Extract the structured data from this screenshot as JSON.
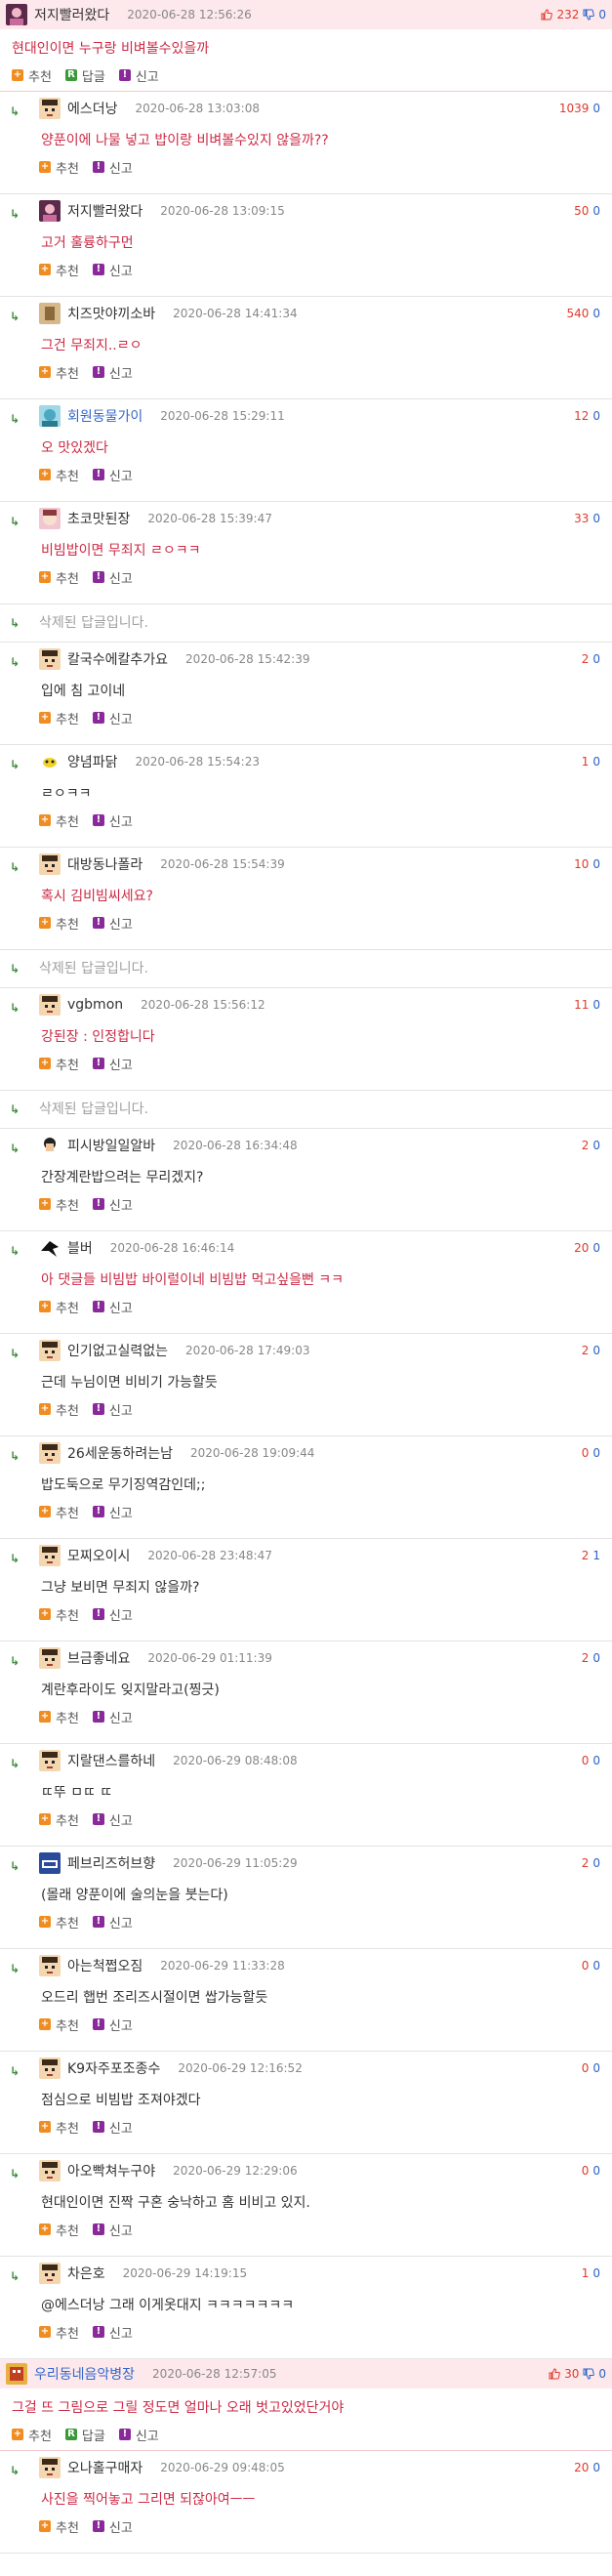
{
  "actions": {
    "recommend": "추천",
    "reply": "답글",
    "report": "신고"
  },
  "deleted_text": "삭제된 답글입니다.",
  "colors": {
    "top_header_bg": "#fde9ec",
    "comment_red": "#cc2a45",
    "reply_arrow": "#3b8c3b",
    "vote_up": "#e0392b",
    "vote_down": "#2a63c7",
    "recommend_icon": "#f08c20",
    "reply_icon": "#3a9a3a",
    "report_icon": "#8a2a9a"
  },
  "thread": [
    {
      "kind": "top",
      "nick": "저지빨러왔다",
      "date": "2020-06-28 12:56:26",
      "text": "현대인이면 누구랑 비벼볼수있을까",
      "up": "232",
      "down": "0",
      "avatar": "av-pink",
      "nick_color": "dark"
    },
    {
      "kind": "reply",
      "nick": "에스더낭",
      "date": "2020-06-28 13:03:08",
      "text": "양푼이에 나물 넣고 밥이랑 비벼볼수있지 않을까??",
      "up": "1039",
      "down": "0",
      "red": true,
      "avatar": "av-face"
    },
    {
      "kind": "reply",
      "nick": "저지빨러왔다",
      "date": "2020-06-28 13:09:15",
      "text": "고거 훌륭하구먼",
      "up": "50",
      "down": "0",
      "red": true,
      "avatar": "av-pink"
    },
    {
      "kind": "reply",
      "nick": "치즈맛야끼소바",
      "date": "2020-06-28 14:41:34",
      "text": "그건 무죄지..ㄹㅇ",
      "up": "540",
      "down": "0",
      "red": true,
      "avatar": "av-tan"
    },
    {
      "kind": "reply",
      "nick": "회원동물가이",
      "date": "2020-06-28 15:29:11",
      "text": "오 맛있겠다",
      "up": "12",
      "down": "0",
      "red": true,
      "avatar": "av-teal",
      "nick_color": "blue"
    },
    {
      "kind": "reply",
      "nick": "초코맛된장",
      "date": "2020-06-28 15:39:47",
      "text": "비빔밥이면 무죄지 ㄹㅇㅋㅋ",
      "up": "33",
      "down": "0",
      "red": true,
      "avatar": "av-anime"
    },
    {
      "kind": "deleted"
    },
    {
      "kind": "reply",
      "nick": "칼국수에칼추가요",
      "date": "2020-06-28 15:42:39",
      "text": "입에 침 고이네",
      "up": "2",
      "down": "0",
      "red": false,
      "avatar": "av-face"
    },
    {
      "kind": "reply",
      "nick": "양념파닭",
      "date": "2020-06-28 15:54:23",
      "text": "ㄹㅇㅋㅋ",
      "up": "1",
      "down": "0",
      "red": false,
      "avatar": "av-chick"
    },
    {
      "kind": "reply",
      "nick": "대방동나폴라",
      "date": "2020-06-28 15:54:39",
      "text": "혹시 김비빔씨세요?",
      "up": "10",
      "down": "0",
      "red": true,
      "avatar": "av-face"
    },
    {
      "kind": "deleted"
    },
    {
      "kind": "reply",
      "nick": "vgbmon",
      "date": "2020-06-28 15:56:12",
      "text": "강된장 : 인정합니다",
      "up": "11",
      "down": "0",
      "red": true,
      "avatar": "av-face"
    },
    {
      "kind": "deleted"
    },
    {
      "kind": "reply",
      "nick": "피시방일일알바",
      "date": "2020-06-28 16:34:48",
      "text": "간장계란밥으려는 무리겠지?",
      "up": "2",
      "down": "0",
      "red": false,
      "avatar": "av-man"
    },
    {
      "kind": "reply",
      "nick": "블버",
      "date": "2020-06-28 16:46:14",
      "text": "아 댓글들 비빔밥 바이럴이네 비빔밥 먹고싶을뻔 ㅋㅋ",
      "up": "20",
      "down": "0",
      "red": true,
      "avatar": "av-bird"
    },
    {
      "kind": "reply",
      "nick": "인기없고실력없는",
      "date": "2020-06-28 17:49:03",
      "text": "근데 누님이면 비비기 가능할듯",
      "up": "2",
      "down": "0",
      "red": false,
      "avatar": "av-face"
    },
    {
      "kind": "reply",
      "nick": "26세운동하려는남",
      "date": "2020-06-28 19:09:44",
      "text": "밥도둑으로 무기징역감인데;;",
      "up": "0",
      "down": "0",
      "red": false,
      "avatar": "av-face"
    },
    {
      "kind": "reply",
      "nick": "모찌오이시",
      "date": "2020-06-28 23:48:47",
      "text": "그냥 보비면 무죄지 않을까?",
      "up": "2",
      "down": "1",
      "red": false,
      "avatar": "av-face"
    },
    {
      "kind": "reply",
      "nick": "브금좋네요",
      "date": "2020-06-29 01:11:39",
      "text": "계란후라이도 잊지말라고(찡긋)",
      "up": "2",
      "down": "0",
      "red": false,
      "avatar": "av-face"
    },
    {
      "kind": "reply",
      "nick": "지랄댄스를하네",
      "date": "2020-06-29 08:48:08",
      "text": "ㄸ뚜 ㅁㄸ ㄸ",
      "up": "0",
      "down": "0",
      "red": false,
      "avatar": "av-face"
    },
    {
      "kind": "reply",
      "nick": "페브리즈허브향",
      "date": "2020-06-29 11:05:29",
      "text": "(몰래 양푼이에 술의눈을 붓는다)",
      "up": "2",
      "down": "0",
      "red": false,
      "avatar": "av-blue"
    },
    {
      "kind": "reply",
      "nick": "아는척쩝오짐",
      "date": "2020-06-29 11:33:28",
      "text": "오드리 햅번 조리즈시절이면 쌉가능할듯",
      "up": "0",
      "down": "0",
      "red": false,
      "avatar": "av-face"
    },
    {
      "kind": "reply",
      "nick": "K9자주포조종수",
      "date": "2020-06-29 12:16:52",
      "text": "점심으로 비빔밥 조져야겠다",
      "up": "0",
      "down": "0",
      "red": false,
      "avatar": "av-face"
    },
    {
      "kind": "reply",
      "nick": "아오빡쳐누구야",
      "date": "2020-06-29 12:29:06",
      "text": "현대인이면 진짝 구혼 숭낙하고 홈 비비고 있지.",
      "up": "0",
      "down": "0",
      "red": false,
      "avatar": "av-face"
    },
    {
      "kind": "reply",
      "nick": "차은호",
      "date": "2020-06-29 14:19:15",
      "text": "@에스더낭 그래 이게옷대지 ㅋㅋㅋㅋㅋㅋㅋ",
      "up": "1",
      "down": "0",
      "red": false,
      "avatar": "av-face"
    },
    {
      "kind": "top",
      "nick": "우리동네음악병장",
      "date": "2020-06-28 12:57:05",
      "text": "그걸 뜨 그림으로 그릴 정도면 얼마나 오래 벗고있었단거야",
      "up": "30",
      "down": "0",
      "avatar": "av-pixel",
      "nick_color": "blue"
    },
    {
      "kind": "reply",
      "nick": "오나홀구매자",
      "date": "2020-06-29 09:48:05",
      "text": "사진을 찍어놓고 그리면 되잖아여ㅡㅡ",
      "up": "20",
      "down": "0",
      "red": true,
      "avatar": "av-face"
    }
  ]
}
